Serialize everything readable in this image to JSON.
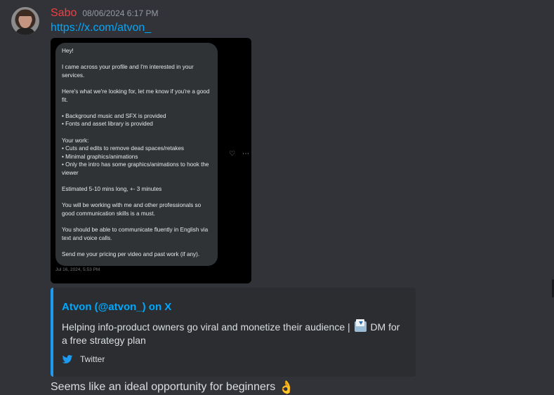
{
  "message": {
    "author": "Sabo",
    "timestamp": "08/06/2024 6:17 PM",
    "link": "https://x.com/atvon_",
    "text": "Seems like an ideal opportunity for beginners",
    "text_emoji": "👌"
  },
  "screenshot": {
    "paragraphs": [
      "Hey!",
      "I came across your profile and I'm interested in your services.",
      "Here's what we're looking for, let me know if you're a good fit.",
      "• Background music and SFX is provided\n• Fonts and asset library is provided",
      "Your work:\n• Cuts and edits to remove dead spaces/retakes\n• Minimal graphics/animations\n• Only the intro has some graphics/animations to hook the viewer",
      "Estimated 5-10 mins long, +- 3 minutes",
      "You will be working with me and other professionals so good communication skills is a must.",
      "You should be able to communicate fluently in English via text and voice calls.",
      "Send me your pricing per video and past work (if any)."
    ],
    "time": "Jul 16, 2024, 5:53 PM",
    "react_icon": "heart-plus-icon",
    "more_icon": "ellipsis-icon",
    "react_glyph": "♡",
    "more_glyph": "⋯"
  },
  "embed": {
    "title": "Atvon (@atvon_) on X",
    "description_before": "Helping info-product owners go viral and monetize their audience |",
    "description_after": "DM for a free strategy plan",
    "description_icon": "envelope-with-arrow-icon",
    "footer": "Twitter",
    "footer_icon": "twitter-bird-icon",
    "accent_color": "#1d9bf0"
  },
  "colors": {
    "background": "#313338",
    "username": "#f23f42",
    "link": "#00a8fc",
    "embed_bg": "#2b2d31"
  }
}
